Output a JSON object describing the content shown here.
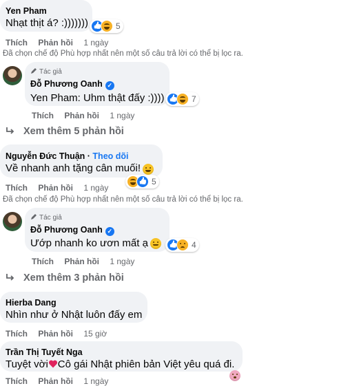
{
  "comments": [
    {
      "name": "Yen Pham",
      "text": "Nhạt thịt á? :)))))))",
      "reactions": [
        "like",
        "haha"
      ],
      "reaction_count": "5",
      "actions": {
        "like": "Thích",
        "reply": "Phản hồi",
        "time": "1 ngày"
      }
    },
    {
      "notice": "Đã chọn chế độ Phù hợp nhất nên một số câu trả lời có thể bị lọc ra."
    },
    {
      "author_tag": "Tác giả",
      "name": "Đỗ Phương Oanh",
      "mention": "Yen Pham:",
      "text": " Uhm thật đấy :))))",
      "reactions": [
        "like",
        "haha"
      ],
      "reaction_count": "7",
      "actions": {
        "like": "Thích",
        "reply": "Phản hồi",
        "time": "1 ngày"
      }
    },
    {
      "more_replies": "Xem thêm 5 phản hồi"
    },
    {
      "name": "Nguyễn Đức Thuận",
      "follow": "Theo dõi",
      "text": "Về nhanh anh tặng cân muối!",
      "reactions": [
        "haha",
        "like"
      ],
      "reaction_count": "5",
      "actions": {
        "like": "Thích",
        "reply": "Phản hồi",
        "time": "1 ngày"
      }
    },
    {
      "notice": "Đã chọn chế độ Phù hợp nhất nên một số câu trả lời có thể bị lọc ra."
    },
    {
      "author_tag": "Tác giả",
      "name": "Đỗ Phương Oanh",
      "text": "Ướp nhanh ko ươn mất ạ",
      "reactions": [
        "like",
        "sad"
      ],
      "reaction_count": "4",
      "actions": {
        "like": "Thích",
        "reply": "Phản hồi",
        "time": "1 ngày"
      }
    },
    {
      "more_replies": "Xem thêm 3 phản hồi"
    },
    {
      "name": "Hierba Dang",
      "text": "Nhìn như ở Nhật luôn đấy em",
      "actions": {
        "like": "Thích",
        "reply": "Phản hồi",
        "time": "15 giờ"
      }
    },
    {
      "name": "Trần Thị Tuyết Nga",
      "text_before": "Tuyệt vời",
      "text_after": "Cô gái Nhật phiên bản Việt yêu quá đi.",
      "actions": {
        "like": "Thích",
        "reply": "Phản hồi",
        "time": "1 ngày"
      }
    }
  ],
  "icons": {
    "like": "like-icon",
    "haha": "haha-icon",
    "sad": "sad-icon",
    "verified": "verified-badge-icon",
    "pencil": "pencil-icon",
    "reply_arrow": "reply-arrow-icon",
    "heart": "red-heart-icon"
  },
  "colors": {
    "bubble": "#f0f2f5",
    "secondary_text": "#65676b",
    "link_blue": "#1877f2",
    "like_blue": "#1877f2",
    "emoji_yellow": "#f7b125"
  }
}
